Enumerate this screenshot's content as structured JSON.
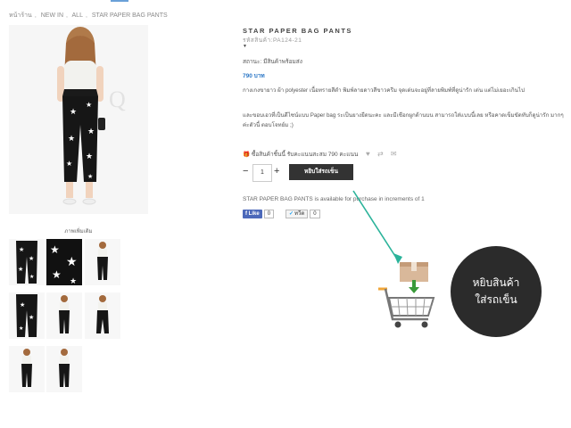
{
  "breadcrumb": [
    {
      "label": "หน้าร้าน"
    },
    {
      "label": "NEW IN"
    },
    {
      "label": "ALL"
    },
    {
      "label": "STAR PAPER BAG PANTS"
    }
  ],
  "breadcrumb_separator": ",",
  "gallery": {
    "more_images_label": "ภาพเพิ่มเติม",
    "watermark": "Q"
  },
  "product": {
    "title": "STAR PAPER BAG PANTS",
    "code": "รหัสสินค้า:PA124-21",
    "status": "สถานะ: มีสินค้าพร้อมส่ง",
    "price": "790 บาท",
    "description_1": "กางเกงขายาว ผ้า polyester เนื้อทรายสีดำ พิมพ์ลายดาวสีขาวครีม  จุดเด่นจะอยู่ที่ลายพิมพ์ที่ดูน่ารัก เด่น แต่ไม่เยอะเกินไป",
    "description_2": "และขอบเอวที่เป็นดีไซน์แบบ Paper bag ระเป็นยางยืดนะคะ และมีเชือกผูกด้านบน สามารถใส่แบบนี้เลย หรือคาดเข็มขัดทับก็ดูน่ารัก มากๆค่ะตัวนี้ ตอบโจทย์ม ;)",
    "points_text": "ซื้อสินค้าชิ้นนี้ รับคะแนนสะสม 790 คะแนน",
    "quantity": "1",
    "minus": "−",
    "plus": "+",
    "add_to_cart": "หยิบใส่รถเข็น",
    "increments_note": "STAR PAPER BAG PANTS is available for purchase in increments of 1"
  },
  "social": {
    "facebook_label": "Like",
    "facebook_count": "0",
    "twitter_label": "ทวีต",
    "twitter_count": "0"
  },
  "callout": {
    "line1": "หยิบสินค้า",
    "line2": "ใส่รถเข็น"
  },
  "colors": {
    "accent_blue": "#2a76c6",
    "button_dark": "#333333",
    "callout_bg": "#2b2b2b",
    "arrow_teal": "#2bb39a",
    "pants_black": "#161616",
    "top_white": "#f2f2ee"
  },
  "icons": [
    "heart-icon",
    "compare-icon",
    "mail-icon",
    "gift-icon",
    "cart-icon",
    "box-icon",
    "down-arrow-icon"
  ]
}
